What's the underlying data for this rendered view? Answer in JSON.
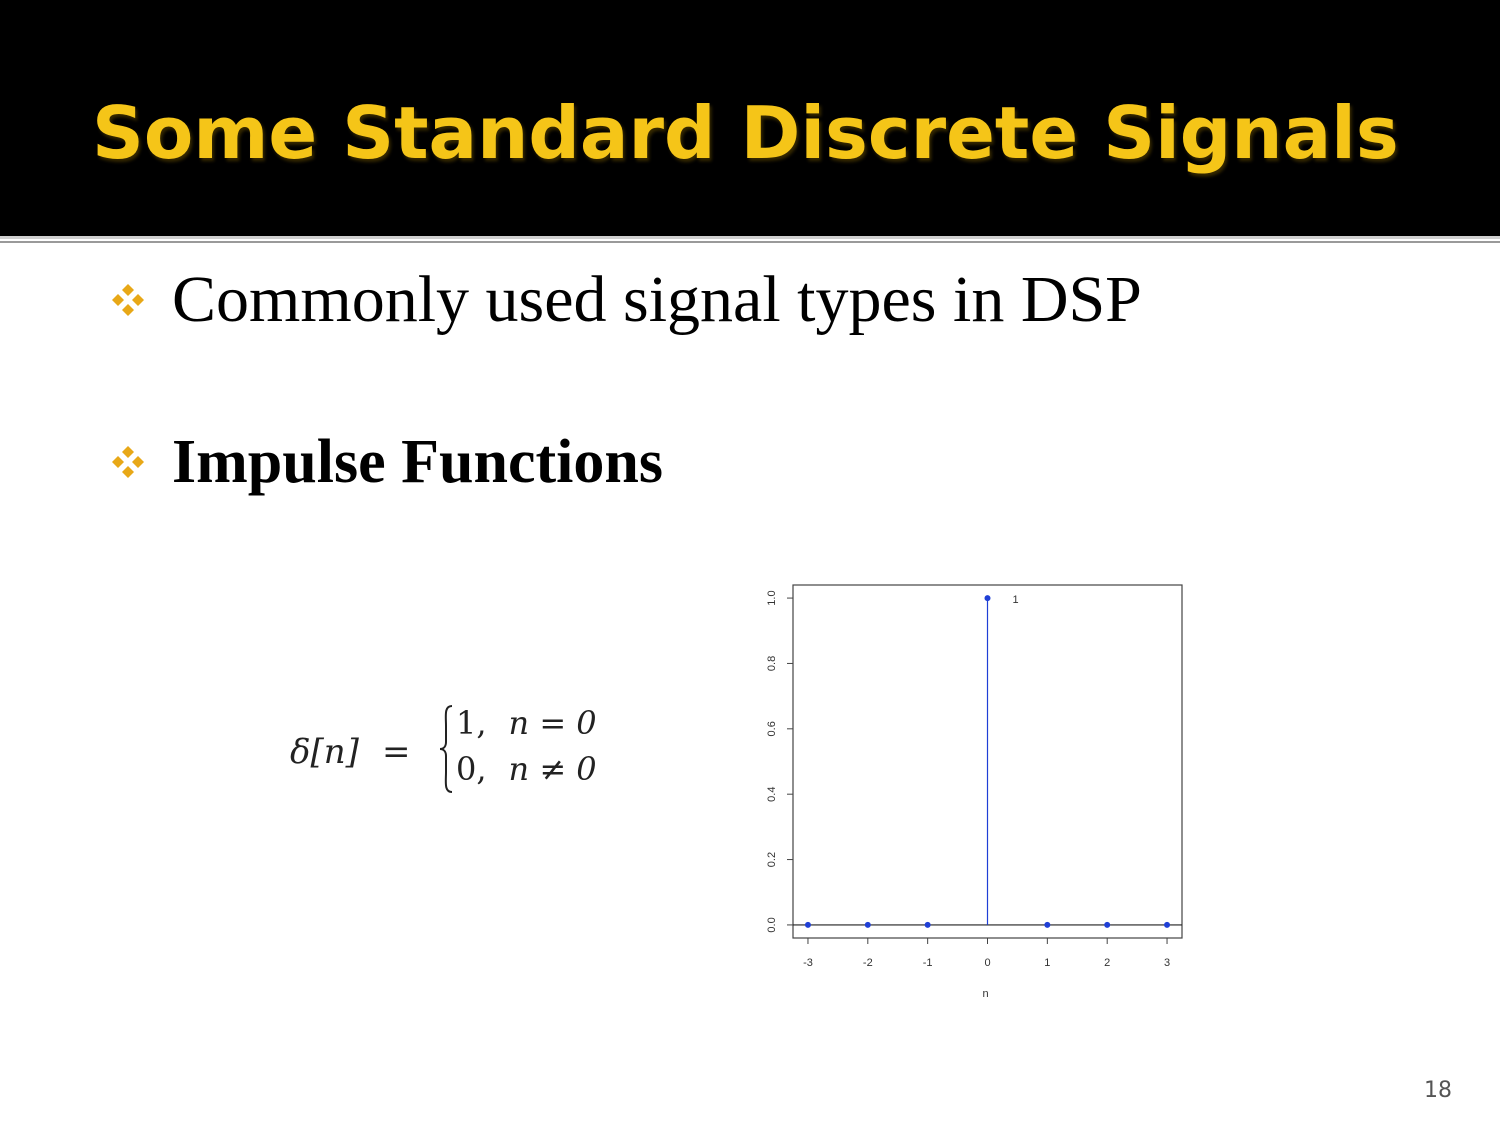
{
  "slide": {
    "title": "Some Standard Discrete Signals",
    "page_number": "18"
  },
  "bullets": [
    {
      "text": "Commonly used signal types in DSP",
      "icon": "diamond-cluster-icon"
    },
    {
      "text": "Impulse Functions",
      "icon": "diamond-cluster-icon"
    }
  ],
  "formula": {
    "lhs": "δ[n]",
    "equals": "=",
    "case1_value": "1,",
    "case1_condition": "n = 0",
    "case2_value": "0,",
    "case2_condition": "n ≠ 0"
  },
  "colors": {
    "title": "#f5c518",
    "title_bar": "#000000",
    "bullet": "#e8a817",
    "stem": "#1f3fd6"
  },
  "chart_data": {
    "type": "scatter",
    "style": "stem",
    "x": [
      -3,
      -2,
      -1,
      0,
      1,
      2,
      3
    ],
    "y": [
      0,
      0,
      0,
      1,
      0,
      0,
      0
    ],
    "xlabel": "n",
    "ylabel": "",
    "x_ticks": [
      "-3",
      "-2",
      "-1",
      "0",
      "1",
      "2",
      "3"
    ],
    "y_ticks": [
      "0.0",
      "0.2",
      "0.4",
      "0.6",
      "0.8",
      "1.0"
    ],
    "xlim": [
      -3.25,
      3.25
    ],
    "ylim": [
      -0.04,
      1.04
    ],
    "annotations": [
      {
        "x": 0,
        "y": 1,
        "text": "1"
      }
    ],
    "grid": false
  }
}
